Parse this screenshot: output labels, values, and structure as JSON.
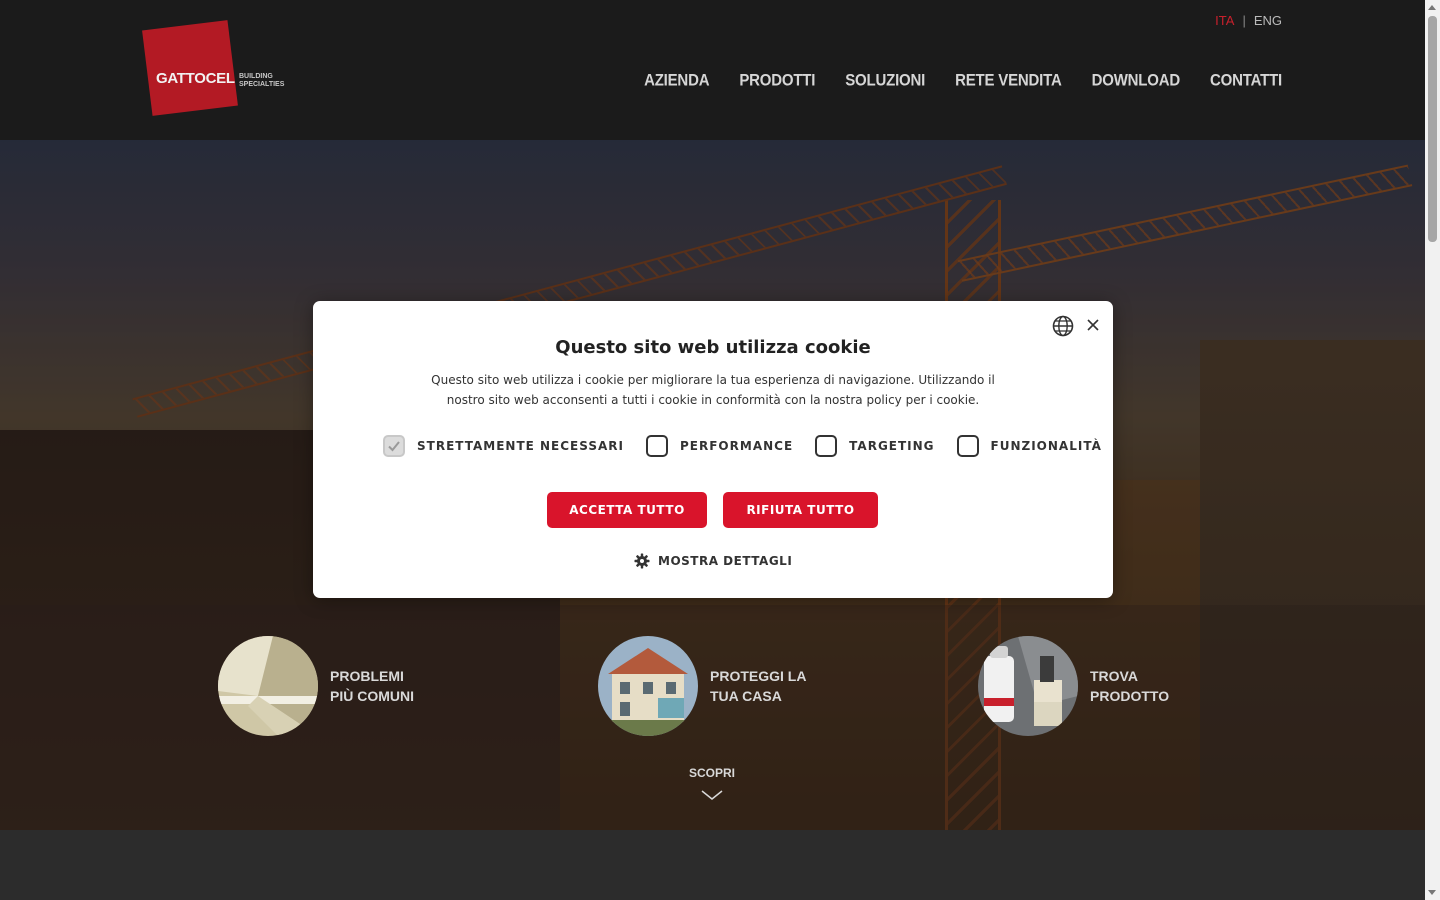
{
  "header": {
    "logo": {
      "name": "GATTOCEL",
      "tagline_line1": "BUILDING",
      "tagline_line2": "SPECIALTIES"
    },
    "languages": [
      {
        "label": "ITA",
        "active": true
      },
      {
        "label": "ENG",
        "active": false
      }
    ],
    "language_separator": "|",
    "nav": [
      "AZIENDA",
      "PRODOTTI",
      "SOLUZIONI",
      "RETE VENDITA",
      "DOWNLOAD",
      "CONTATTI"
    ]
  },
  "features": [
    {
      "line1": "PROBLEMI",
      "line2": "PIÙ COMUNI"
    },
    {
      "line1": "PROTEGGI LA",
      "line2": "TUA CASA"
    },
    {
      "line1": "TROVA",
      "line2": "PRODOTTO"
    }
  ],
  "scopri_label": "SCOPRI",
  "cookie_modal": {
    "title": "Questo sito web utilizza cookie",
    "text": "Questo sito web utilizza i cookie per migliorare la tua esperienza di navigazione. Utilizzando il nostro sito web acconsenti a tutti i cookie in conformità con la nostra policy per i cookie.",
    "options": [
      {
        "label": "STRETTAMENTE NECESSARI",
        "checked": true
      },
      {
        "label": "PERFORMANCE",
        "checked": false
      },
      {
        "label": "TARGETING",
        "checked": false
      },
      {
        "label": "FUNZIONALITÀ",
        "checked": false
      }
    ],
    "accept_label": "ACCETTA TUTTO",
    "reject_label": "RIFIUTA TUTTO",
    "details_label": "MOSTRA DETTAGLI"
  },
  "colors": {
    "accent": "#d9142b",
    "logo_red": "#b31a24",
    "header_bg": "#1b1b1b",
    "nav_text": "#d6d6d6",
    "active_lang": "#c8202c"
  },
  "icons": [
    "globe-icon",
    "close-icon",
    "checkmark-icon",
    "gear-icon",
    "chevron-down-icon"
  ]
}
